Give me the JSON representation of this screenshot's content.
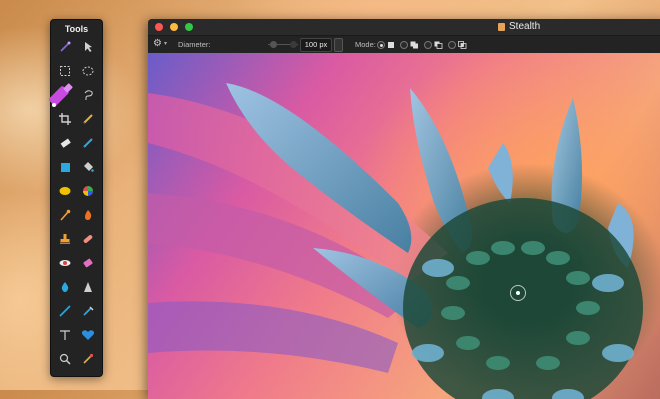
{
  "tools_panel": {
    "title": "Tools",
    "tools": [
      {
        "name": "magic-wand-icon",
        "color": "#8a6bd1"
      },
      {
        "name": "move-arrow-icon",
        "color": "#cfcfcf"
      },
      {
        "name": "rect-select-icon",
        "color": "#cfcfcf"
      },
      {
        "name": "ellipse-select-icon",
        "color": "#cfcfcf"
      },
      {
        "name": "brush-icon",
        "color": "#c84be0"
      },
      {
        "name": "lasso-icon",
        "color": "#cfcfcf"
      },
      {
        "name": "crop-icon",
        "color": "#cfcfcf"
      },
      {
        "name": "pen-icon",
        "color": "#e0b040"
      },
      {
        "name": "eraser-icon",
        "color": "#e6e6e6"
      },
      {
        "name": "pencil-icon",
        "color": "#2aa9e0"
      },
      {
        "name": "rectangle-shape-icon",
        "color": "#2aa9e0"
      },
      {
        "name": "paint-bucket-icon",
        "color": "#cfcfcf"
      },
      {
        "name": "gradient-icon",
        "color": "#f0c000"
      },
      {
        "name": "color-wheel-icon",
        "color": "#e05050"
      },
      {
        "name": "smudge-icon",
        "color": "#f0a030"
      },
      {
        "name": "burn-icon",
        "color": "#f07020"
      },
      {
        "name": "clone-stamp-icon",
        "color": "#f0a030"
      },
      {
        "name": "bandage-icon",
        "color": "#f09080"
      },
      {
        "name": "red-eye-icon",
        "color": "#e04040"
      },
      {
        "name": "sponge-icon",
        "color": "#e070c0"
      },
      {
        "name": "blur-drop-icon",
        "color": "#2aa9e0"
      },
      {
        "name": "sharpen-icon",
        "color": "#cfcfcf"
      },
      {
        "name": "line-icon",
        "color": "#2aa9e0"
      },
      {
        "name": "vector-pen-icon",
        "color": "#2aa9e0"
      },
      {
        "name": "text-tool-icon",
        "color": "#d0d0d0"
      },
      {
        "name": "heart-shape-icon",
        "color": "#2a8fe0"
      },
      {
        "name": "zoom-icon",
        "color": "#cfcfcf"
      },
      {
        "name": "eyedropper-icon",
        "color": "#e0b040"
      }
    ]
  },
  "window": {
    "title": "Stealth",
    "options": {
      "gear_icon": "gear-icon",
      "diameter_label": "Diameter:",
      "diameter_value": "100 px",
      "mode_label": "Mode:"
    }
  }
}
